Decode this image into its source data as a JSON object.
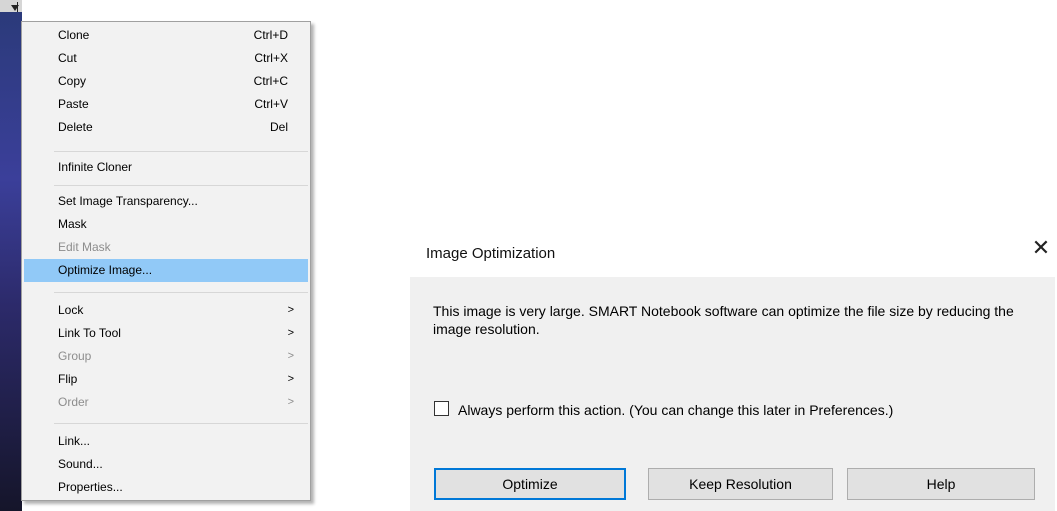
{
  "context_menu": {
    "items": [
      {
        "label": "Clone",
        "shortcut": "Ctrl+D"
      },
      {
        "label": "Cut",
        "shortcut": "Ctrl+X"
      },
      {
        "label": "Copy",
        "shortcut": "Ctrl+C"
      },
      {
        "label": "Paste",
        "shortcut": "Ctrl+V"
      },
      {
        "label": "Delete",
        "shortcut": "Del"
      },
      {
        "label": "Infinite Cloner"
      },
      {
        "label": "Set Image Transparency..."
      },
      {
        "label": "Mask"
      },
      {
        "label": "Edit Mask",
        "state": "disabled"
      },
      {
        "label": "Optimize Image...",
        "state": "selected"
      },
      {
        "label": "Lock",
        "submenu_arrow": ">"
      },
      {
        "label": "Link To Tool",
        "submenu_arrow": ">"
      },
      {
        "label": "Group",
        "submenu_arrow": ">",
        "state": "disabled"
      },
      {
        "label": "Flip",
        "submenu_arrow": ">"
      },
      {
        "label": "Order",
        "submenu_arrow": ">",
        "state": "disabled"
      },
      {
        "label": "Link..."
      },
      {
        "label": "Sound..."
      },
      {
        "label": "Properties..."
      }
    ]
  },
  "dialog": {
    "title": "Image Optimization",
    "close_glyph": "✕",
    "message": "This image is very large. SMART Notebook software can optimize the file size by reducing the image resolution.",
    "checkbox_label": "Always perform this action. (You can change this later in Preferences.)",
    "checkbox_checked": false,
    "buttons": {
      "optimize": "Optimize",
      "keep_resolution": "Keep Resolution",
      "help": "Help"
    }
  },
  "colors": {
    "menu_bg": "#f2f2f2",
    "selected_bg": "#91c9f7",
    "disabled_text": "#8d8d8d",
    "dialog_body_bg": "#f0f0f0",
    "default_button_border": "#0078d7"
  }
}
